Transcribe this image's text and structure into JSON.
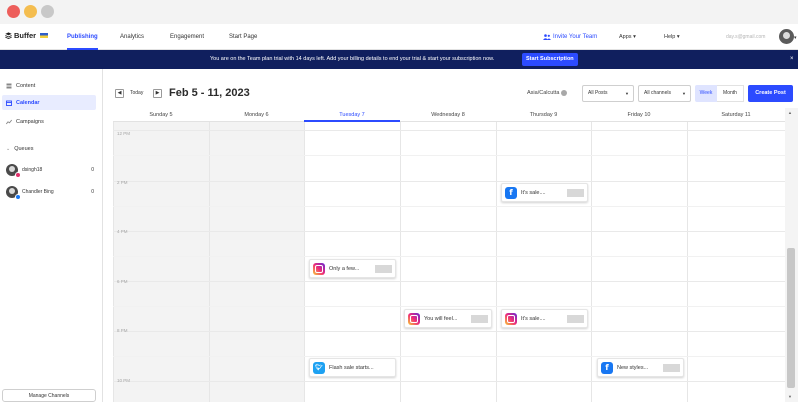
{
  "topnav": {
    "logo": "Buffer",
    "tabs": [
      "Publishing",
      "Analytics",
      "Engagement",
      "Start Page"
    ],
    "invite": "Invite Your Team",
    "apps": "Apps",
    "help": "Help",
    "email": "day.s@gmail.com"
  },
  "banner": {
    "text": "You are on the Team plan trial with 14 days left. Add your billing details to end your trial & start your subscription now.",
    "button": "Start Subscription",
    "close": "×"
  },
  "sidebar": {
    "items": [
      "Content",
      "Calendar",
      "Campaigns"
    ],
    "queues_label": "Queues",
    "queues": [
      {
        "name": "dsingh18",
        "count": "0",
        "network_color": "#e1306c"
      },
      {
        "name": "Chandler Bing",
        "count": "0",
        "network_color": "#1877f2"
      }
    ],
    "manage": "Manage Channels"
  },
  "toolbar": {
    "prev": "◀",
    "today": "Today",
    "next": "▶",
    "range": "Feb 5 - 11, 2023",
    "timezone": "Asia/Calcutta",
    "filter_posts": "All Posts",
    "filter_channels": "All channels",
    "view_week": "Week",
    "view_month": "Month",
    "create": "Create Post"
  },
  "days": [
    "Sunday  5",
    "Monday  6",
    "Tuesday  7",
    "Wednesday  8",
    "Thursday  9",
    "Friday  10",
    "Saturday  11"
  ],
  "times": [
    "12 PM",
    "2 PM",
    "4 PM",
    "6 PM",
    "8 PM",
    "10 PM"
  ],
  "posts": [
    {
      "network": "fb",
      "text": "It's sale...."
    },
    {
      "network": "ig",
      "text": "Only a few..."
    },
    {
      "network": "ig",
      "text": "You will feel..."
    },
    {
      "network": "ig",
      "text": "It's sale...."
    },
    {
      "network": "tw",
      "text": "Flash sale starts..."
    },
    {
      "network": "fb",
      "text": "New styles..."
    }
  ],
  "colors": {
    "accent": "#2c4bff",
    "banner": "#101f5e",
    "past": "#f3f3f3"
  }
}
